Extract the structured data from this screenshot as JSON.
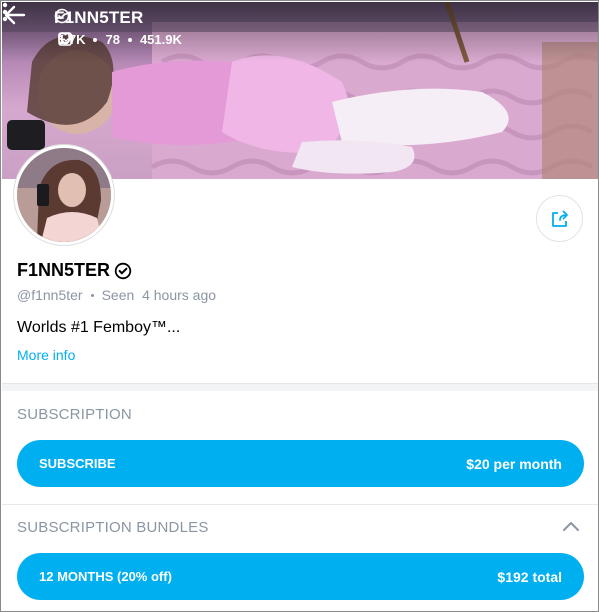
{
  "header": {
    "title": "F1NN5TER",
    "stats": [
      {
        "icon": "image-icon",
        "value": "1.7K"
      },
      {
        "icon": "video-icon",
        "value": "78"
      },
      {
        "icon": "heart-icon",
        "value": "451.9K"
      }
    ]
  },
  "profile": {
    "name": "F1NN5TER",
    "handle": "@f1nn5ter",
    "seen": "Seen  4 hours ago",
    "bio": "Worlds #1 Femboy™...",
    "more_info": "More info"
  },
  "subscription": {
    "label": "SUBSCRIPTION",
    "button_label": "SUBSCRIBE",
    "price": "$20 per month"
  },
  "bundles": {
    "label": "SUBSCRIPTION BUNDLES",
    "items": [
      {
        "label": "12 MONTHS (20% off)",
        "price": "$192 total"
      }
    ]
  },
  "colors": {
    "accent": "#00aff0",
    "muted": "#8a96a3"
  }
}
